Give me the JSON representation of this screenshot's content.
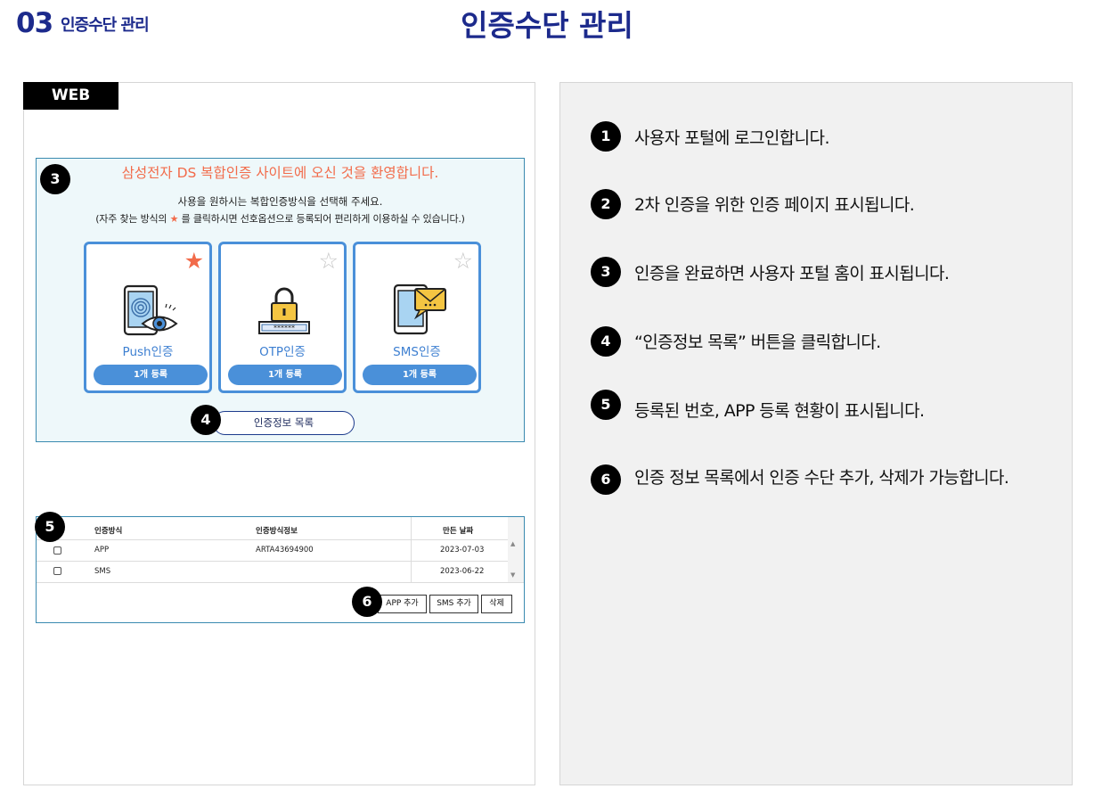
{
  "header": {
    "number": "03",
    "subtitle": "인증수단 관리",
    "title": "인증수단 관리"
  },
  "left": {
    "tag": "WEB",
    "auth": {
      "badge": "3",
      "welcome": "삼성전자 DS 복합인증 사이트에 오신 것을 환영합니다.",
      "instruction1": "사용을 원하시는 복합인증방식을 선택해 주세요.",
      "instruction2_before": "(자주 찾는 방식의 ",
      "instruction2_star": "★",
      "instruction2_after": " 를 클릭하시면 선호옵션으로 등록되어 편리하게 이용하실 수 있습니다.)",
      "cards": [
        {
          "name": "Push인증",
          "button": "1개 등록",
          "star": "★",
          "favorite": true,
          "icon": "fingerprint-phone-icon"
        },
        {
          "name": "OTP인증",
          "button": "1개 등록",
          "star": "☆",
          "favorite": false,
          "icon": "padlock-otp-icon"
        },
        {
          "name": "SMS인증",
          "button": "1개 등록",
          "star": "☆",
          "favorite": false,
          "icon": "phone-message-icon"
        }
      ],
      "list_badge": "4",
      "list_button": "인증정보 목록"
    },
    "table": {
      "badge": "5",
      "columns": [
        "인증방식",
        "인증방식정보",
        "만든 날짜"
      ],
      "rows": [
        {
          "method": "APP",
          "info": "ARTA43694900",
          "date": "2023-07-03",
          "checked": false
        },
        {
          "method": "SMS",
          "info": "",
          "date": "2023-06-22",
          "checked": false
        }
      ],
      "action_badge": "6",
      "buttons": {
        "add_app": "APP 추가",
        "add_sms": "SMS 추가",
        "delete": "삭제"
      }
    }
  },
  "steps": [
    {
      "num": "1",
      "text": "사용자 포털에 로그인합니다."
    },
    {
      "num": "2",
      "text": "2차 인증을 위한 인증 페이지 표시됩니다."
    },
    {
      "num": "3",
      "text": "인증을 완료하면 사용자 포털 홈이 표시됩니다."
    },
    {
      "num": "4",
      "text": " “인증정보 목록” 버튼을 클릭합니다."
    },
    {
      "num": "5",
      "text": "등록된 번호, APP 등록 현황이 표시됩니다."
    },
    {
      "num": "6",
      "text": "인증 정보 목록에서 인증 수단 추가, 삭제가 가능합니다."
    }
  ],
  "colors": {
    "title_navy": "#1c2a8c",
    "accent_orange": "#f26b4a",
    "card_blue": "#4a90d9",
    "panel_gray": "#f1f1f1"
  }
}
